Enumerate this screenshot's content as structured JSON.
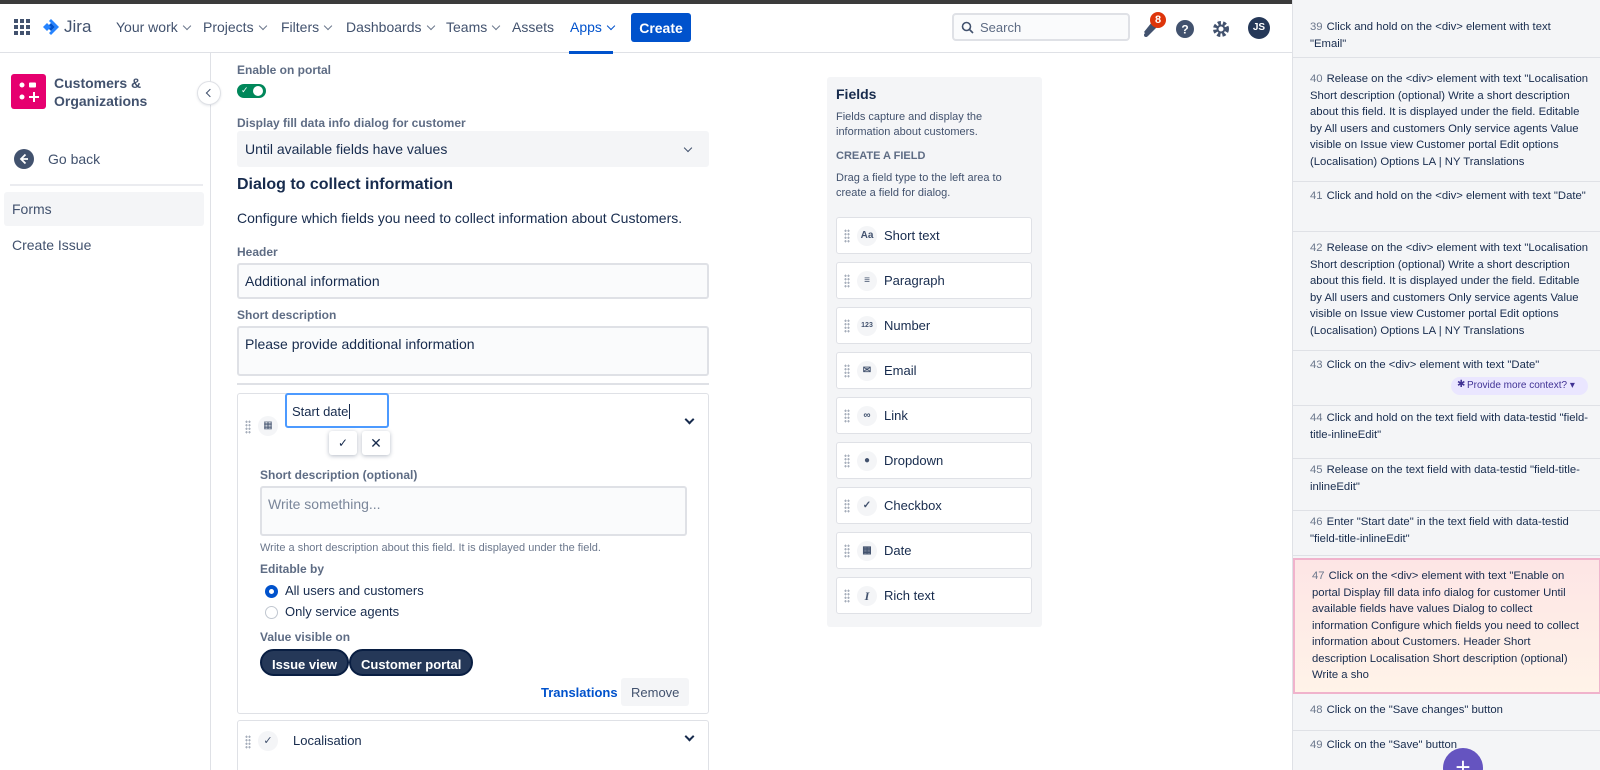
{
  "topbar": {
    "app_name": "Jira",
    "nav": [
      {
        "label": "Your work"
      },
      {
        "label": "Projects"
      },
      {
        "label": "Filters"
      },
      {
        "label": "Dashboards"
      },
      {
        "label": "Teams"
      },
      {
        "label": "Assets"
      },
      {
        "label": "Apps"
      }
    ],
    "create_label": "Create",
    "search_placeholder": "Search",
    "notification_count": "8",
    "avatar_initials": "JS"
  },
  "sidebar": {
    "project_name": "Customers & Organizations",
    "go_back": "Go back",
    "items": [
      {
        "label": "Forms"
      },
      {
        "label": "Create Issue"
      }
    ]
  },
  "main": {
    "enable_portal_label": "Enable on portal",
    "display_fill_label": "Display fill data info dialog for customer",
    "display_fill_value": "Until available fields have values",
    "dialog_title": "Dialog to collect information",
    "dialog_desc": "Configure which fields you need to collect information about Customers.",
    "header_label": "Header",
    "header_value": "Additional information",
    "short_desc_label": "Short description",
    "short_desc_value": "Please provide additional information",
    "field_card": {
      "title_value": "Start date",
      "short_desc_label": "Short description (optional)",
      "short_desc_placeholder": "Write something...",
      "short_desc_help": "Write a short description about this field. It is displayed under the field.",
      "editable_label": "Editable by",
      "editable_options": [
        "All users and customers",
        "Only service agents"
      ],
      "visible_label": "Value visible on",
      "visible_pills": [
        "Issue view",
        "Customer portal"
      ],
      "translations": "Translations",
      "remove": "Remove"
    },
    "second_card_title": "Localisation"
  },
  "fields_panel": {
    "title": "Fields",
    "desc": "Fields capture and display the information about customers.",
    "create_title": "CREATE A FIELD",
    "create_desc": "Drag a field type to the left area to create a field for dialog.",
    "types": [
      {
        "label": "Short text",
        "icon": "Aa"
      },
      {
        "label": "Paragraph",
        "icon": "≡"
      },
      {
        "label": "Number",
        "icon": "123"
      },
      {
        "label": "Email",
        "icon": "✉"
      },
      {
        "label": "Link",
        "icon": "∞"
      },
      {
        "label": "Dropdown",
        "icon": "●"
      },
      {
        "label": "Checkbox",
        "icon": "✓"
      },
      {
        "label": "Date",
        "icon": "▦"
      },
      {
        "label": "Rich text",
        "icon": "I"
      }
    ]
  },
  "steps": [
    {
      "num": "39",
      "text": "Click and hold on the <div> element with text \"Email\""
    },
    {
      "num": "40",
      "text": "Release on the <div> element with text \"Localisation Short description (optional) Write a short description about this field. It is displayed under the field. Editable by All users and customers Only service agents Value visible on Issue view Customer portal Edit options (Localisation) Options LA | NY Translations"
    },
    {
      "num": "41",
      "text": "Click and hold on the <div> element with text \"Date\""
    },
    {
      "num": "42",
      "text": "Release on the <div> element with text \"Localisation Short description (optional) Write a short description about this field. It is displayed under the field. Editable by All users and customers Only service agents Value visible on Issue view Customer portal Edit options (Localisation) Options LA | NY Translations"
    },
    {
      "num": "43",
      "text": "Click on the <div> element with text \"Date\""
    },
    {
      "num": "44",
      "text": "Click and hold on the text field with data-testid \"field-title-inlineEdit\""
    },
    {
      "num": "45",
      "text": "Release on the text field with data-testid \"field-title-inlineEdit\""
    },
    {
      "num": "46",
      "text": "Enter \"Start date\" in the text field with data-testid \"field-title-inlineEdit\""
    },
    {
      "num": "47",
      "text": "Click on the <div> element with text \"Enable on portal Display fill data info dialog for customer Until available fields have values Dialog to collect information Configure which fields you need to collect information about Customers. Header Short description Localisation Short description (optional) Write a sho"
    },
    {
      "num": "48",
      "text": "Click on the \"Save changes\" button"
    },
    {
      "num": "49",
      "text": "Click on the \"Save\" button"
    }
  ],
  "context_button": "Provide more context?",
  "colors": {
    "brand": "#0052cc",
    "logo": "#e6006f",
    "toggle": "#00875a",
    "assistant": "#6554c0"
  }
}
